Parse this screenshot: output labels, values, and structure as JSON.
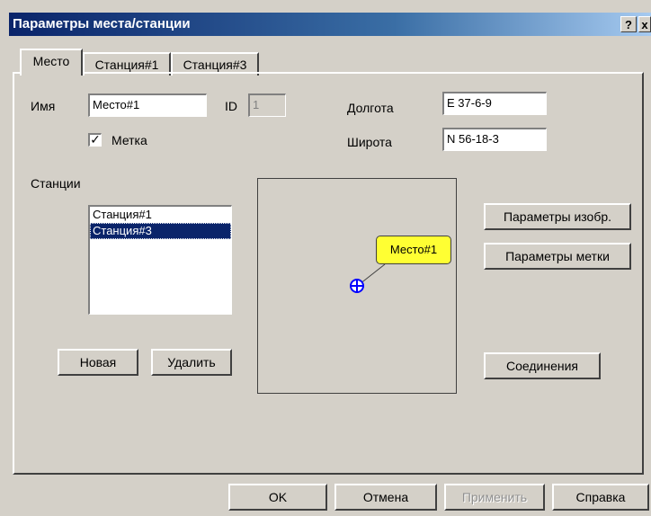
{
  "window": {
    "title": "Параметры места/станции",
    "help_label": "?",
    "close_label": "x"
  },
  "tabs": [
    {
      "label": "Место",
      "active": true
    },
    {
      "label": "Станция#1",
      "active": false
    },
    {
      "label": "Станция#3",
      "active": false
    }
  ],
  "place": {
    "name_label": "Имя",
    "name_value": "Место#1",
    "id_label": "ID",
    "id_value": "1",
    "marker_checkbox_label": "Метка",
    "marker_checked": true,
    "marker_check_glyph": "✓",
    "longitude_label": "Долгота",
    "longitude_value": "E 37-6-9",
    "latitude_label": "Широта",
    "latitude_value": "N 56-18-3"
  },
  "stations": {
    "label": "Станции",
    "items": [
      "Станция#1",
      "Станция#3"
    ],
    "selected_index": 1,
    "new_button": "Новая",
    "delete_button": "Удалить"
  },
  "preview": {
    "marker_text": "Место#1",
    "marker_color": "#ffff33",
    "place_icon": "crosshair-circle-icon",
    "place_icon_color": "#0000ff"
  },
  "side_buttons": {
    "image_params": "Параметры изобр.",
    "marker_params": "Параметры метки",
    "connections": "Соединения"
  },
  "footer": {
    "ok": "OK",
    "cancel": "Отмена",
    "apply": "Применить",
    "apply_enabled": false,
    "help": "Справка"
  },
  "colors": {
    "titlebar": "#0a246a",
    "face": "#d4d0c8",
    "selection": "#0a246a"
  }
}
